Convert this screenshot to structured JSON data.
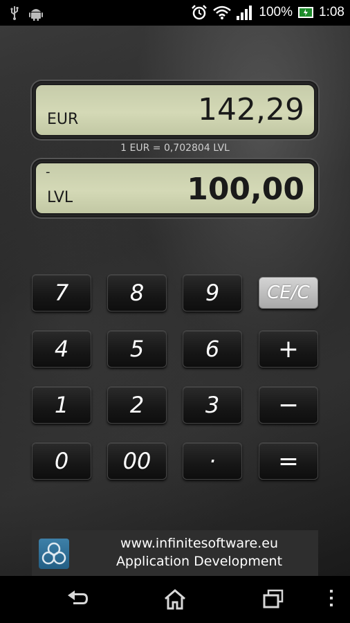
{
  "status_bar": {
    "battery_percent": "100%",
    "time": "1:08",
    "icons": [
      "usb-icon",
      "android-icon",
      "alarm-icon",
      "wifi-icon",
      "signal-icon",
      "battery-charging-icon"
    ]
  },
  "converter": {
    "top": {
      "currency": "EUR",
      "value": "142,29",
      "sign": ""
    },
    "rate": "1 EUR = 0,702804 LVL",
    "bottom": {
      "currency": "LVL",
      "value": "100,00",
      "sign": "-"
    }
  },
  "keypad": {
    "rows": [
      [
        "7",
        "8",
        "9",
        "CE/C"
      ],
      [
        "4",
        "5",
        "6",
        "+"
      ],
      [
        "1",
        "2",
        "3",
        "−"
      ],
      [
        "0",
        "00",
        "·",
        "="
      ]
    ]
  },
  "banner": {
    "line1": "www.infinitesoftware.eu",
    "line2": "Application Development"
  },
  "navbar": {
    "icons": [
      "back-icon",
      "home-icon",
      "recent-apps-icon",
      "menu-icon"
    ]
  },
  "colors": {
    "lcd": "#d4d9b6",
    "key": "#161616",
    "ce_key": "#b8b8b8",
    "logo": "#2f6f95"
  }
}
